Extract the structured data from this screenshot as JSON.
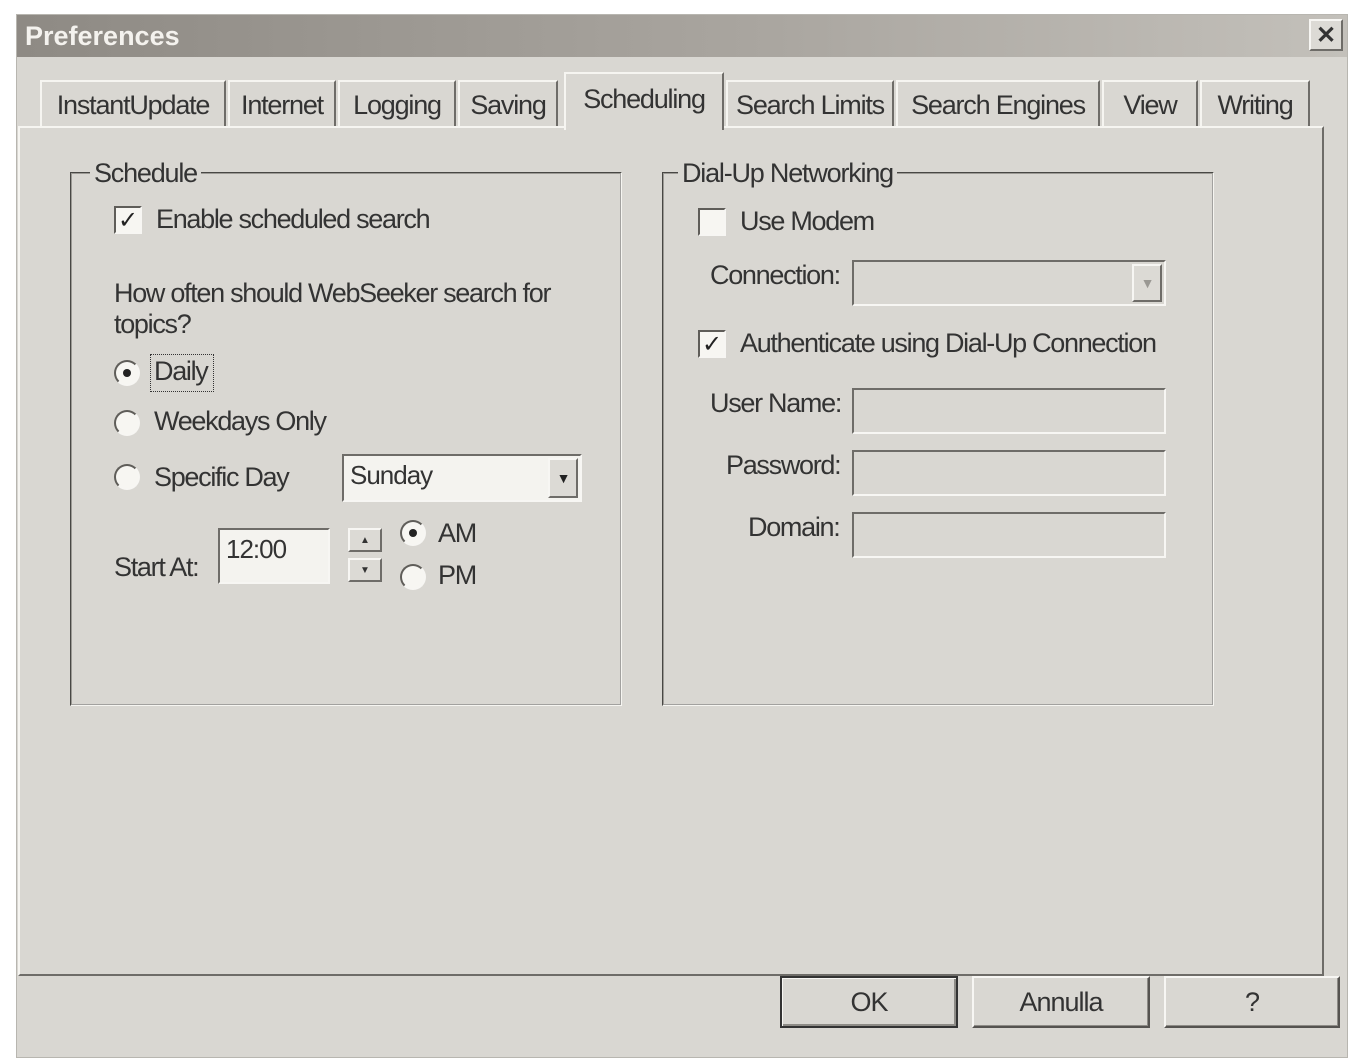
{
  "window": {
    "title": "Preferences",
    "close_glyph": "✕"
  },
  "tabs": [
    {
      "label": "InstantUpdate",
      "active": false
    },
    {
      "label": "Internet",
      "active": false
    },
    {
      "label": "Logging",
      "active": false
    },
    {
      "label": "Saving",
      "active": false
    },
    {
      "label": "Scheduling",
      "active": true
    },
    {
      "label": "Search Limits",
      "active": false
    },
    {
      "label": "Search Engines",
      "active": false
    },
    {
      "label": "View",
      "active": false
    },
    {
      "label": "Writing",
      "active": false
    }
  ],
  "schedule": {
    "title": "Schedule",
    "enable_label": "Enable scheduled search",
    "enable_checked": true,
    "question": "How often should WebSeeker search for topics?",
    "options": [
      {
        "label": "Daily",
        "selected": true
      },
      {
        "label": "Weekdays Only",
        "selected": false
      },
      {
        "label": "Specific Day",
        "selected": false
      }
    ],
    "day_value": "Sunday",
    "start_label": "Start At:",
    "start_value": "12:00",
    "ampm": [
      {
        "label": "AM",
        "selected": true
      },
      {
        "label": "PM",
        "selected": false
      }
    ]
  },
  "dialup": {
    "title": "Dial-Up Networking",
    "use_modem_label": "Use Modem",
    "use_modem_checked": false,
    "connection_label": "Connection:",
    "connection_value": "",
    "auth_label": "Authenticate using Dial-Up Connection",
    "auth_checked": true,
    "username_label": "User Name:",
    "password_label": "Password:",
    "domain_label": "Domain:",
    "username_value": "",
    "password_value": "",
    "domain_value": ""
  },
  "buttons": {
    "ok": "OK",
    "cancel": "Annulla",
    "help": "?"
  },
  "glyphs": {
    "check": "✓",
    "dropdown_arrow": "▼",
    "spin_up": "▲",
    "spin_down": "▼"
  }
}
